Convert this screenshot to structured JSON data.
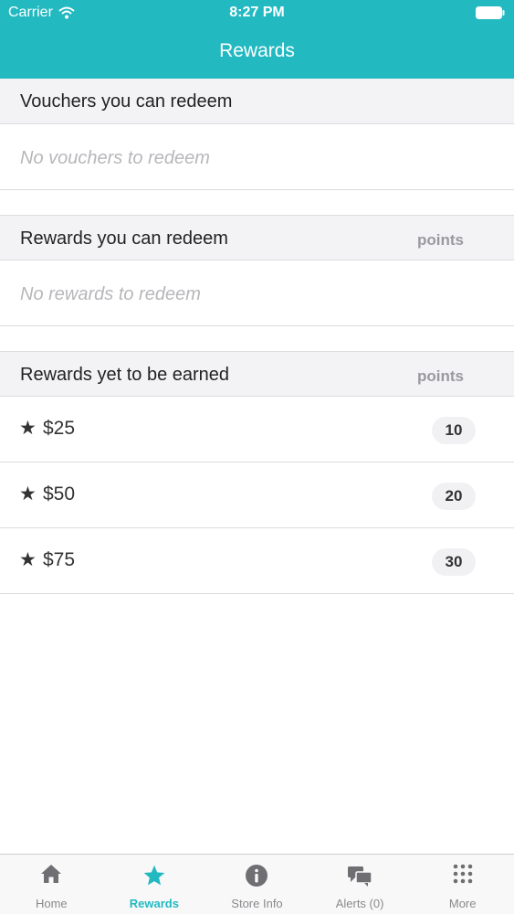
{
  "status_bar": {
    "carrier": "Carrier",
    "time": "8:27 PM"
  },
  "nav": {
    "title": "Rewards"
  },
  "sections": {
    "vouchers": {
      "title": "Vouchers you can redeem",
      "empty_text": "No vouchers to redeem"
    },
    "redeemable": {
      "title": "Rewards you can redeem",
      "points_header": "points",
      "empty_text": "No rewards to redeem"
    },
    "earn": {
      "title": "Rewards yet to be earned",
      "points_header": "points",
      "items": [
        {
          "label": "$25",
          "points": "10"
        },
        {
          "label": "$50",
          "points": "20"
        },
        {
          "label": "$75",
          "points": "30"
        }
      ]
    }
  },
  "star_glyph": "★",
  "tabs": [
    {
      "label": "Home",
      "icon": "home-icon"
    },
    {
      "label": "Rewards",
      "icon": "star-icon",
      "active": true
    },
    {
      "label": "Store Info",
      "icon": "info-icon"
    },
    {
      "label": "Alerts (0)",
      "icon": "chat-bubbles-icon"
    },
    {
      "label": "More",
      "icon": "grid-dots-icon"
    }
  ],
  "colors": {
    "accent": "#22b9c1",
    "tab_inactive": "#8a8a8e"
  }
}
